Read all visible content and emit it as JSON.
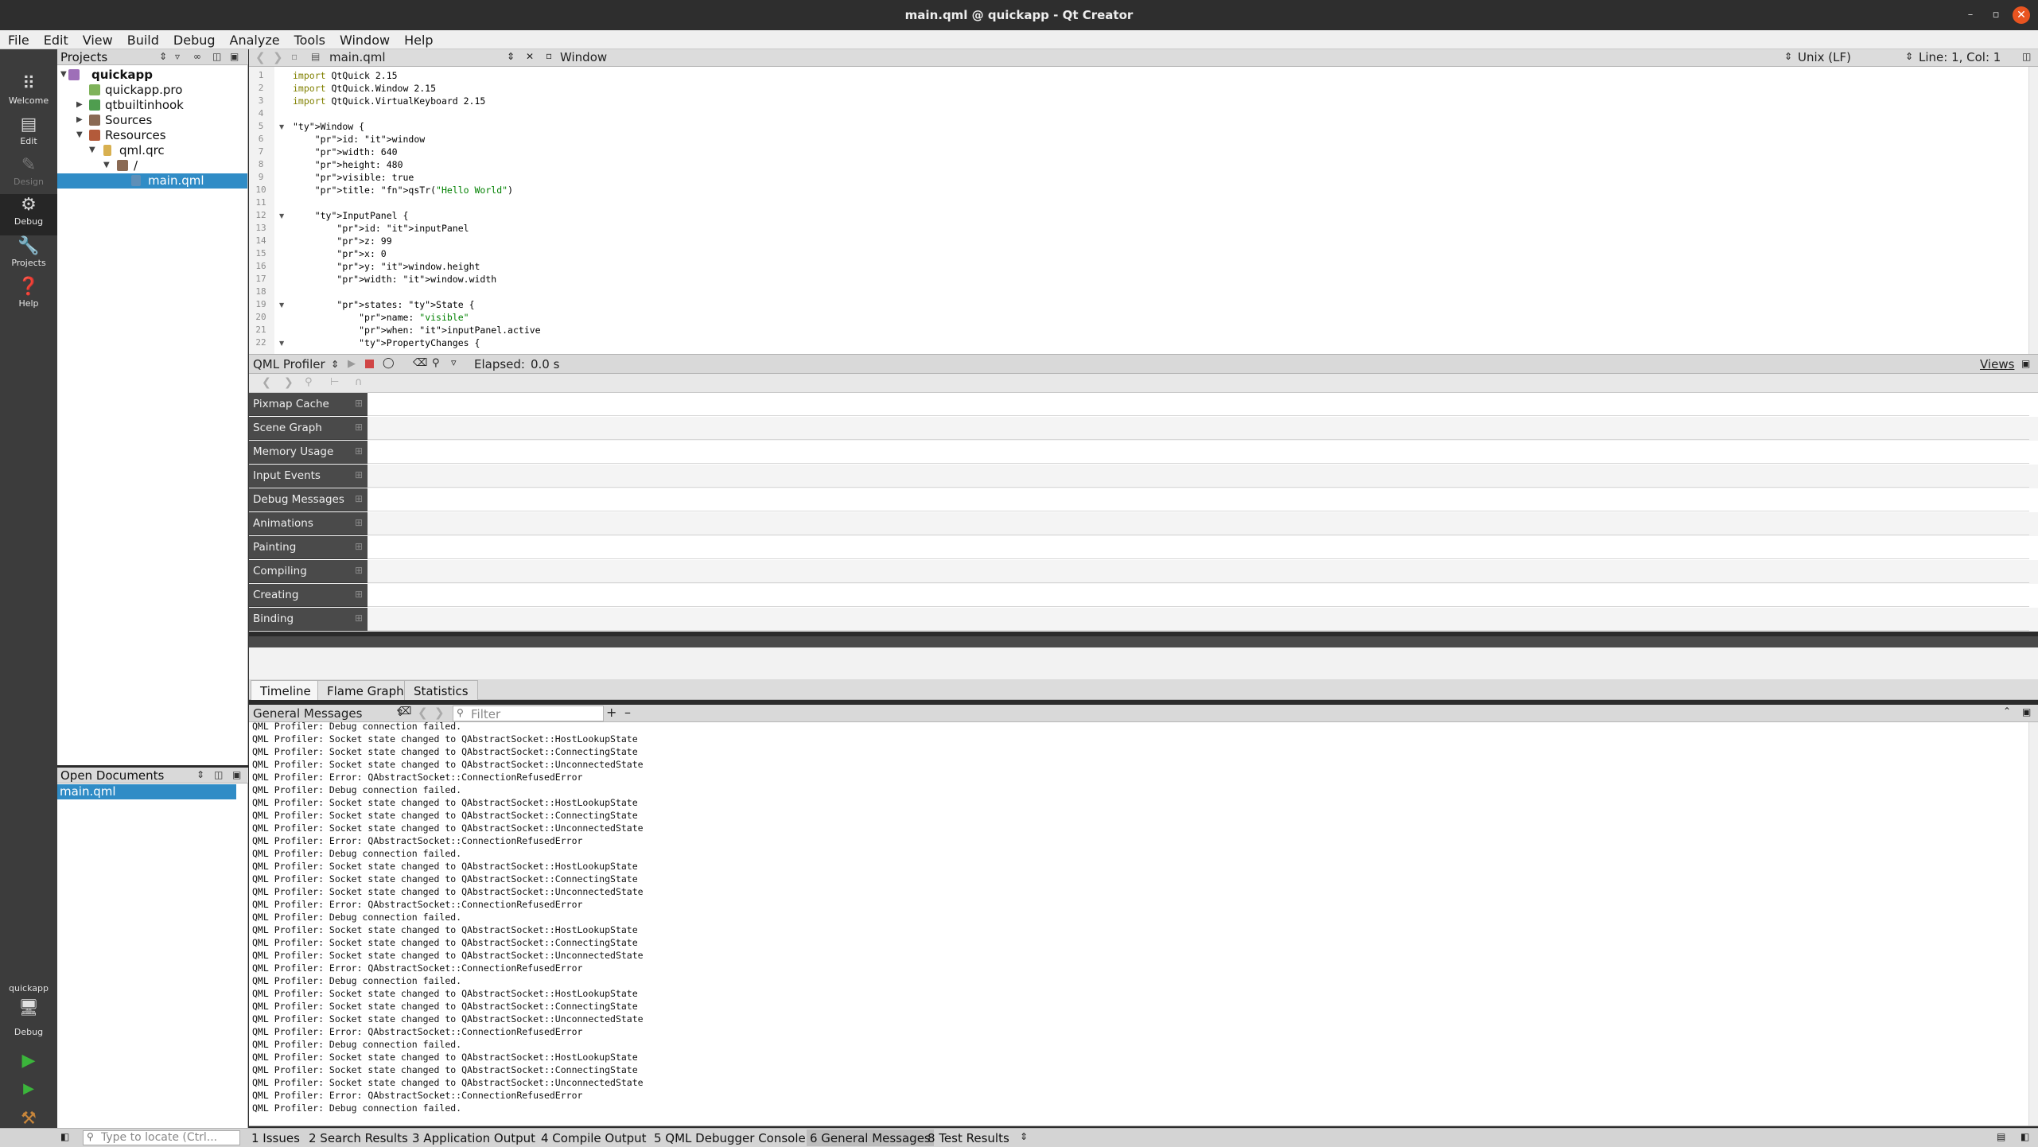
{
  "window": {
    "title": "main.qml @ quickapp - Qt Creator",
    "close_color": "#e95420"
  },
  "menu": [
    "File",
    "Edit",
    "View",
    "Build",
    "Debug",
    "Analyze",
    "Tools",
    "Window",
    "Help"
  ],
  "modes": [
    {
      "label": "Welcome",
      "icon": "grid-icon"
    },
    {
      "label": "Edit",
      "icon": "document-icon"
    },
    {
      "label": "Design",
      "icon": "pencil-icon",
      "disabled": true
    },
    {
      "label": "Debug",
      "icon": "bug-icon",
      "active": true
    },
    {
      "label": "Projects",
      "icon": "wrench-icon"
    },
    {
      "label": "Help",
      "icon": "help-icon"
    }
  ],
  "kit": {
    "project": "quickapp",
    "config": "Debug"
  },
  "projects": {
    "title": "Projects",
    "tree": [
      {
        "label": "quickapp",
        "bold": true
      },
      {
        "label": "quickapp.pro"
      },
      {
        "label": "qtbuiltinhook"
      },
      {
        "label": "Sources"
      },
      {
        "label": "Resources"
      },
      {
        "label": "qml.qrc"
      },
      {
        "label": "/"
      },
      {
        "label": "main.qml",
        "selected": true
      }
    ]
  },
  "open_documents": {
    "title": "Open Documents",
    "items": [
      "main.qml"
    ]
  },
  "editor": {
    "file": "main.qml",
    "symbol": "Window",
    "line_endings": "Unix (LF)",
    "position": "Line: 1, Col: 1"
  },
  "profiler": {
    "title": "QML Profiler",
    "elapsed_label": "Elapsed:",
    "elapsed": "0.0 s",
    "views_label": "Views",
    "categories": [
      "Pixmap Cache",
      "Scene Graph",
      "Memory Usage",
      "Input Events",
      "Debug Messages",
      "Animations",
      "Painting",
      "Compiling",
      "Creating",
      "Binding"
    ],
    "tabs": [
      "Timeline",
      "Flame Graph",
      "Statistics"
    ],
    "active_tab": "Timeline"
  },
  "messages": {
    "title": "General Messages",
    "filter_placeholder": "Filter",
    "lines": [
      "QML Profiler: Debug connection failed.",
      "QML Profiler: Socket state changed to QAbstractSocket::HostLookupState",
      "QML Profiler: Socket state changed to QAbstractSocket::ConnectingState",
      "QML Profiler: Socket state changed to QAbstractSocket::UnconnectedState",
      "QML Profiler: Error: QAbstractSocket::ConnectionRefusedError",
      "QML Profiler: Debug connection failed.",
      "QML Profiler: Socket state changed to QAbstractSocket::HostLookupState",
      "QML Profiler: Socket state changed to QAbstractSocket::ConnectingState",
      "QML Profiler: Socket state changed to QAbstractSocket::UnconnectedState",
      "QML Profiler: Error: QAbstractSocket::ConnectionRefusedError",
      "QML Profiler: Debug connection failed.",
      "QML Profiler: Socket state changed to QAbstractSocket::HostLookupState",
      "QML Profiler: Socket state changed to QAbstractSocket::ConnectingState",
      "QML Profiler: Socket state changed to QAbstractSocket::UnconnectedState",
      "QML Profiler: Error: QAbstractSocket::ConnectionRefusedError",
      "QML Profiler: Debug connection failed.",
      "QML Profiler: Socket state changed to QAbstractSocket::HostLookupState",
      "QML Profiler: Socket state changed to QAbstractSocket::ConnectingState",
      "QML Profiler: Socket state changed to QAbstractSocket::UnconnectedState",
      "QML Profiler: Error: QAbstractSocket::ConnectionRefusedError",
      "QML Profiler: Debug connection failed.",
      "QML Profiler: Socket state changed to QAbstractSocket::HostLookupState",
      "QML Profiler: Socket state changed to QAbstractSocket::ConnectingState",
      "QML Profiler: Socket state changed to QAbstractSocket::UnconnectedState",
      "QML Profiler: Error: QAbstractSocket::ConnectionRefusedError",
      "QML Profiler: Debug connection failed.",
      "QML Profiler: Socket state changed to QAbstractSocket::HostLookupState",
      "QML Profiler: Socket state changed to QAbstractSocket::ConnectingState",
      "QML Profiler: Socket state changed to QAbstractSocket::UnconnectedState",
      "QML Profiler: Error: QAbstractSocket::ConnectionRefusedError",
      "QML Profiler: Debug connection failed."
    ]
  },
  "statusbar": {
    "locator_placeholder": "Type to locate (Ctrl...",
    "tabs": [
      {
        "num": "1",
        "label": "Issues"
      },
      {
        "num": "2",
        "label": "Search Results"
      },
      {
        "num": "3",
        "label": "Application Output"
      },
      {
        "num": "4",
        "label": "Compile Output"
      },
      {
        "num": "5",
        "label": "QML Debugger Console"
      },
      {
        "num": "6",
        "label": "General Messages",
        "active": true
      },
      {
        "num": "8",
        "label": "Test Results"
      }
    ]
  },
  "code_lines": [
    "import QtQuick 2.15",
    "import QtQuick.Window 2.15",
    "import QtQuick.VirtualKeyboard 2.15",
    "",
    "Window {",
    "    id: window",
    "    width: 640",
    "    height: 480",
    "    visible: true",
    "    title: qsTr(\"Hello World\")",
    "",
    "    InputPanel {",
    "        id: inputPanel",
    "        z: 99",
    "        x: 0",
    "        y: window.height",
    "        width: window.width",
    "",
    "        states: State {",
    "            name: \"visible\"",
    "            when: inputPanel.active",
    "            PropertyChanges {"
  ]
}
